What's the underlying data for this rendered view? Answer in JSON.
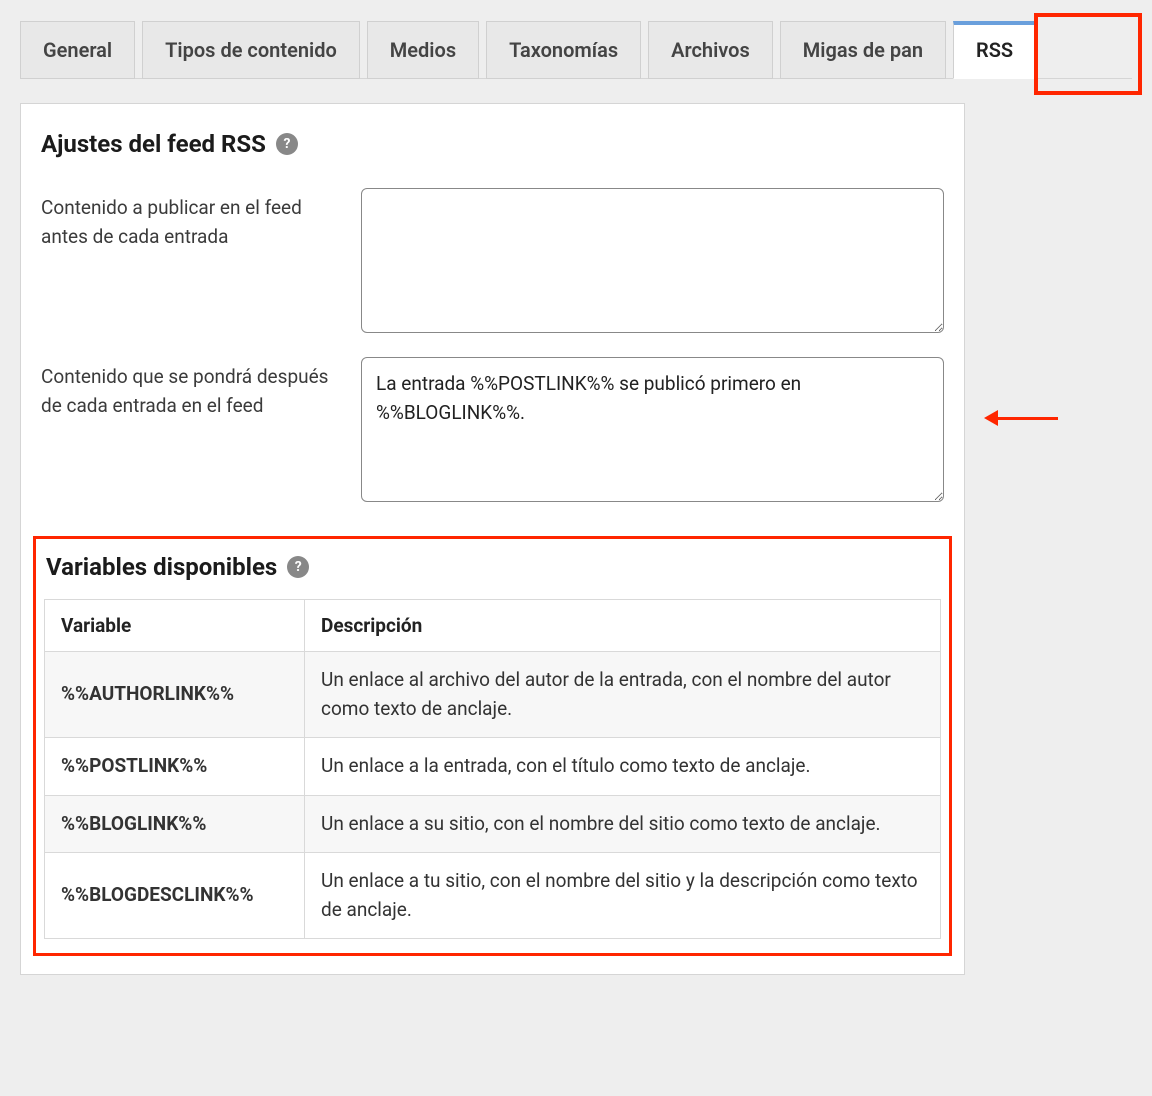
{
  "tabs": [
    {
      "label": "General",
      "active": false
    },
    {
      "label": "Tipos de contenido",
      "active": false
    },
    {
      "label": "Medios",
      "active": false
    },
    {
      "label": "Taxonomías",
      "active": false
    },
    {
      "label": "Archivos",
      "active": false
    },
    {
      "label": "Migas de pan",
      "active": false
    },
    {
      "label": "RSS",
      "active": true
    }
  ],
  "rss": {
    "title": "Ajustes del feed RSS",
    "before_label": "Contenido a publicar en el feed antes de cada entrada",
    "before_value": "",
    "after_label": "Contenido que se pondrá después de cada entrada en el feed",
    "after_value": "La entrada %%POSTLINK%% se publicó primero en %%BLOGLINK%%."
  },
  "variables": {
    "title": "Variables disponibles",
    "headers": {
      "variable": "Variable",
      "description": "Descripción"
    },
    "rows": [
      {
        "name": "%%AUTHORLINK%%",
        "desc": "Un enlace al archivo del autor de la entrada, con el nombre del autor como texto de anclaje."
      },
      {
        "name": "%%POSTLINK%%",
        "desc": "Un enlace a la entrada, con el título como texto de anclaje."
      },
      {
        "name": "%%BLOGLINK%%",
        "desc": "Un enlace a su sitio, con el nombre del sitio como texto de anclaje."
      },
      {
        "name": "%%BLOGDESCLINK%%",
        "desc": "Un enlace a tu sitio, con el nombre del sitio y la descripción como texto de anclaje."
      }
    ]
  },
  "help_glyph": "?"
}
